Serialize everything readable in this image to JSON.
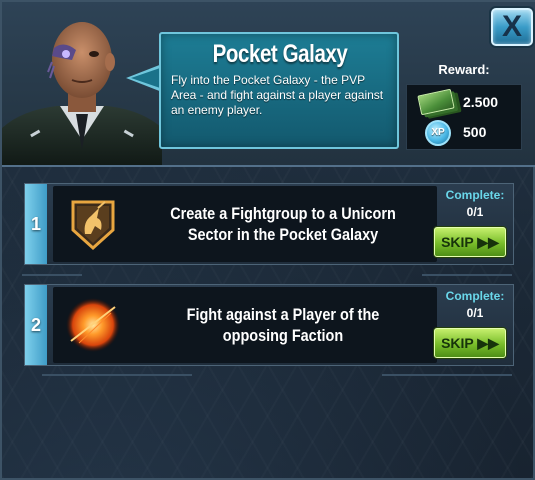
{
  "mission": {
    "title": "Pocket Galaxy",
    "description": "Fly into the Pocket Galaxy - the PVP Area - and fight against a player against an enemy player."
  },
  "reward": {
    "label": "Reward:",
    "money_value": "2.500",
    "xp_badge": "XP",
    "xp_value": "500"
  },
  "close_button": {
    "label": "X"
  },
  "tasks": [
    {
      "number": "1",
      "text": "Create a Fightgroup to a Unicorn Sector in the Pocket Galaxy",
      "icon": "unicorn-emblem-icon",
      "complete_label": "Complete:",
      "progress": "0/1",
      "skip_label": "SKIP ▶▶"
    },
    {
      "number": "2",
      "text": "Fight against a Player of the opposing Faction",
      "icon": "explosion-icon",
      "complete_label": "Complete:",
      "progress": "0/1",
      "skip_label": "SKIP ▶▶"
    }
  ],
  "colors": {
    "accent_cyan": "#6ad7ea",
    "skip_green": "#79bd2a",
    "bubble_teal": "#1d7d95"
  }
}
